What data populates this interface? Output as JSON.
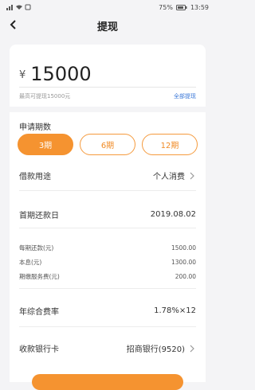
{
  "status": {
    "left_icons": "signal/wifi/notification",
    "battery": "75%",
    "time": "13:59"
  },
  "header": {
    "title": "提现"
  },
  "amount": {
    "currency": "¥",
    "value": "15000",
    "max_hint": "最高可提现15000元",
    "withdraw_all": "全部提现"
  },
  "periods": {
    "label": "申请期数",
    "options": [
      "3期",
      "6期",
      "12期"
    ],
    "selected": "3期"
  },
  "rows": {
    "purpose": {
      "label": "借款用途",
      "value": "个人消费"
    },
    "first_date": {
      "label": "首期还款日",
      "value": "2019.08.02"
    },
    "per_period": {
      "label": "每期还款(元)",
      "value": "1500.00"
    },
    "principal": {
      "label": "本息(元)",
      "value": "1300.00"
    },
    "service_fee": {
      "label": "期缴服务费(元)",
      "value": "200.00"
    },
    "annual_rate": {
      "label": "年综合费率",
      "value": "1.78%×12"
    },
    "bank_card": {
      "label": "收款银行卡",
      "value": "招商银行(9520)"
    }
  },
  "colors": {
    "accent": "#f59330",
    "link": "#3b78d8",
    "background": "#f4f4f6"
  }
}
